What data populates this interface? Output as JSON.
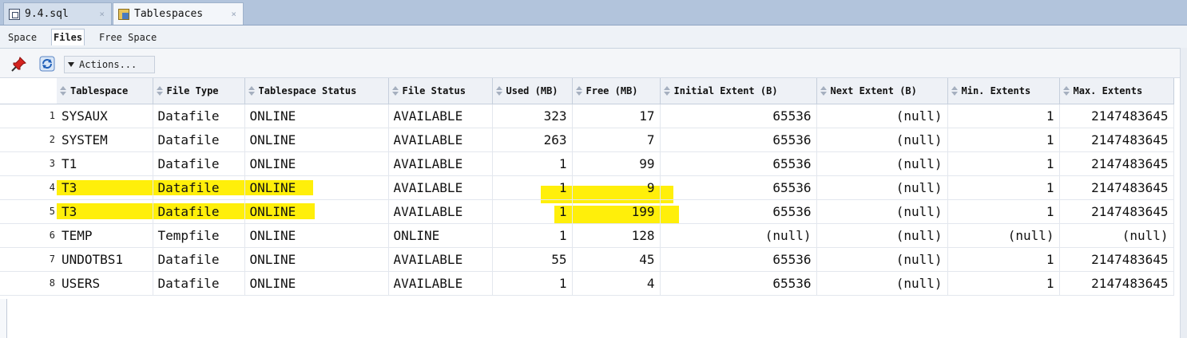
{
  "tabs": [
    {
      "label": "9.4.sql",
      "close": "×"
    },
    {
      "label": "Tablespaces",
      "close": "×"
    }
  ],
  "subtabs": [
    "Space",
    "Files",
    "Free Space"
  ],
  "toolbar": {
    "actions_label": "Actions..."
  },
  "grid": {
    "columns": [
      "Tablespace",
      "File Type",
      "Tablespace Status",
      "File Status",
      "Used (MB)",
      "Free (MB)",
      "Initial Extent (B)",
      "Next Extent (B)",
      "Min. Extents",
      "Max. Extents"
    ],
    "rows": [
      {
        "n": "1",
        "cells": [
          "SYSAUX",
          "Datafile",
          "ONLINE",
          "AVAILABLE",
          "323",
          "17",
          "65536",
          "(null)",
          "1",
          "2147483645"
        ]
      },
      {
        "n": "2",
        "cells": [
          "SYSTEM",
          "Datafile",
          "ONLINE",
          "AVAILABLE",
          "263",
          "7",
          "65536",
          "(null)",
          "1",
          "2147483645"
        ]
      },
      {
        "n": "3",
        "cells": [
          "T1",
          "Datafile",
          "ONLINE",
          "AVAILABLE",
          "1",
          "99",
          "65536",
          "(null)",
          "1",
          "2147483645"
        ]
      },
      {
        "n": "4",
        "cells": [
          "T3",
          "Datafile",
          "ONLINE",
          "AVAILABLE",
          "1",
          "9",
          "65536",
          "(null)",
          "1",
          "2147483645"
        ]
      },
      {
        "n": "5",
        "cells": [
          "T3",
          "Datafile",
          "ONLINE",
          "AVAILABLE",
          "1",
          "199",
          "65536",
          "(null)",
          "1",
          "2147483645"
        ]
      },
      {
        "n": "6",
        "cells": [
          "TEMP",
          "Tempfile",
          "ONLINE",
          "ONLINE",
          "1",
          "128",
          "(null)",
          "(null)",
          "(null)",
          "(null)"
        ]
      },
      {
        "n": "7",
        "cells": [
          "UNDOTBS1",
          "Datafile",
          "ONLINE",
          "AVAILABLE",
          "55",
          "45",
          "65536",
          "(null)",
          "1",
          "2147483645"
        ]
      },
      {
        "n": "8",
        "cells": [
          "USERS",
          "Datafile",
          "ONLINE",
          "AVAILABLE",
          "1",
          "4",
          "65536",
          "(null)",
          "1",
          "2147483645"
        ]
      }
    ]
  },
  "colors": {
    "highlight": "#ffef0a",
    "tabbar": "#b2c4dc"
  }
}
